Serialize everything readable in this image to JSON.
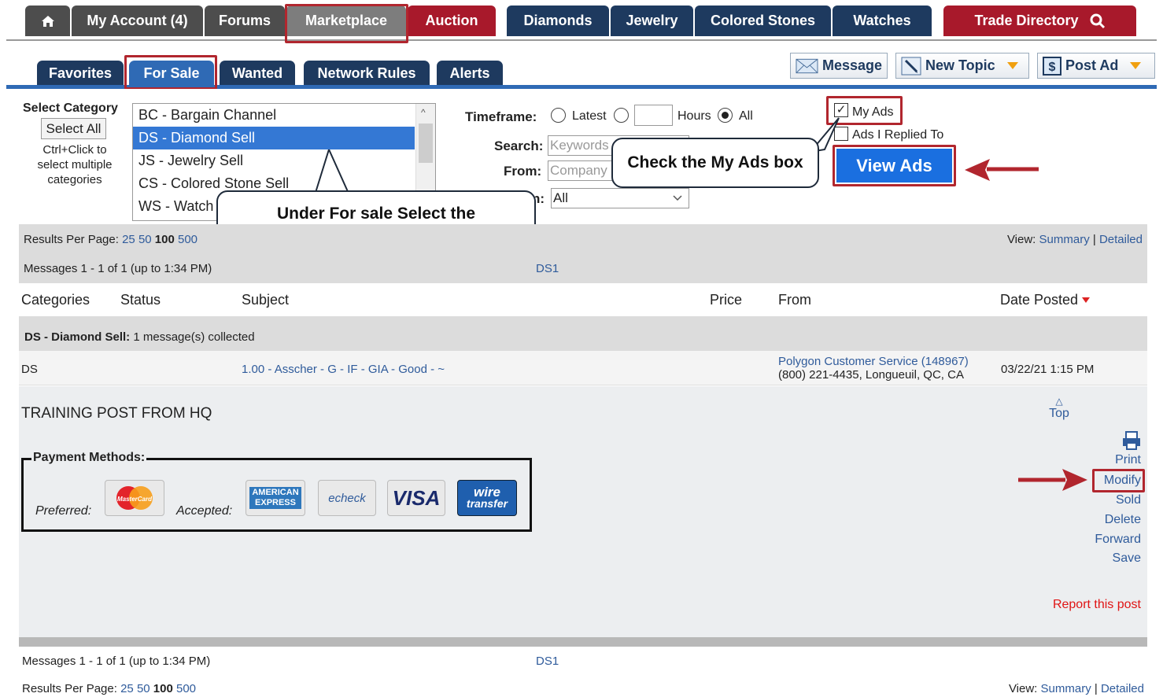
{
  "topnav": {
    "home_icon": "home-icon",
    "tabs": [
      {
        "label": "My Account (4)"
      },
      {
        "label": "Forums"
      },
      {
        "label": "Marketplace"
      },
      {
        "label": "Auction"
      },
      {
        "label": "Diamonds"
      },
      {
        "label": "Jewelry"
      },
      {
        "label": "Colored Stones"
      },
      {
        "label": "Watches"
      }
    ],
    "trade_directory": "Trade Directory"
  },
  "subnav": {
    "tabs": [
      {
        "label": "Favorites"
      },
      {
        "label": "For Sale"
      },
      {
        "label": "Wanted"
      },
      {
        "label": "Network Rules"
      },
      {
        "label": "Alerts"
      }
    ],
    "message": "Message",
    "new_topic": "New Topic",
    "post_ad": "Post Ad"
  },
  "filters": {
    "select_category": "Select Category",
    "select_all": "Select All",
    "hint": "Ctrl+Click to select multiple categories",
    "categories": [
      "BC - Bargain Channel",
      "DS - Diamond Sell",
      "JS - Jewelry Sell",
      "CS - Colored Stone Sell",
      "WS - Watch Sell"
    ],
    "timeframe_label": "Timeframe:",
    "latest": "Latest",
    "hours": "Hours",
    "all": "All",
    "search_label": "Search:",
    "search_placeholder": "Keywords",
    "from_label": "From:",
    "from_placeholder": "Company",
    "location_label": "n:",
    "location_value": "All",
    "my_ads": "My Ads",
    "ads_replied": "Ads I Replied To",
    "view_ads": "View Ads"
  },
  "callouts": {
    "my_ads": "Check the My Ads box",
    "category": "Under For sale Select the category you posted the ad to"
  },
  "results": {
    "per_page_label": "Results Per Page:",
    "per_page": [
      "25",
      "50",
      "100",
      "500"
    ],
    "view_label": "View:",
    "summary": "Summary",
    "detailed": "Detailed",
    "messages": "Messages 1 - 1 of 1 (up to 1:34 PM)",
    "page_link": "DS1",
    "columns": {
      "categories": "Categories",
      "status": "Status",
      "subject": "Subject",
      "price": "Price",
      "from": "From",
      "date": "Date Posted"
    },
    "group_title": "DS - Diamond Sell:",
    "group_count": "1 message(s) collected",
    "row": {
      "category": "DS",
      "subject": "1.00 - Asscher - G - IF - GIA - Good - ~",
      "from_name": "Polygon Customer Service (148967)",
      "from_detail": "(800) 221-4435, Longueuil,  QC, CA",
      "date": "03/22/21 1:15 PM"
    },
    "post_title": "TRAINING POST FROM HQ",
    "payment_legend": "Payment Methods:",
    "preferred": "Preferred:",
    "accepted": "Accepted:",
    "cards": {
      "mastercard": "MasterCard",
      "amex1": "AMERICAN",
      "amex2": "EXPRESS",
      "echeck": "echeck",
      "visa": "VISA",
      "wire1": "wire",
      "wire2": "transfer"
    },
    "actions": {
      "top": "Top",
      "print": "Print",
      "modify": "Modify",
      "sold": "Sold",
      "delete": "Delete",
      "forward": "Forward",
      "save": "Save",
      "report": "Report this post"
    }
  },
  "colors": {
    "navy": "#1e3a5f",
    "red": "#a8192b",
    "blue": "#2f6ab5",
    "highlight": "#b1262e"
  }
}
